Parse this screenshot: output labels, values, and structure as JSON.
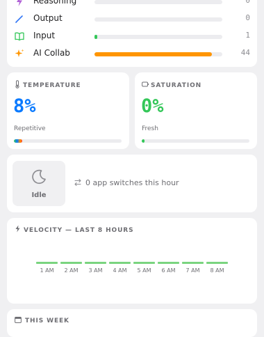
{
  "tokens": [
    {
      "label": "Reasoning",
      "count": "0",
      "fill": 0,
      "color": "#b061d6",
      "icon": "lightning-icon"
    },
    {
      "label": "Output",
      "count": "0",
      "fill": 0,
      "color": "#3478f6",
      "icon": "pencil-icon"
    },
    {
      "label": "Input",
      "count": "1",
      "fill": 0.02,
      "color": "#34c759",
      "icon": "book-icon"
    },
    {
      "label": "AI Collab",
      "count": "44",
      "fill": 0.92,
      "color": "#ff9500",
      "icon": "sparkle-icon"
    }
  ],
  "temperature": {
    "heading": "TEMPERATURE",
    "value": "8%",
    "label": "Repetitive",
    "color": "#0a7aff",
    "icon": "thermometer-icon"
  },
  "saturation": {
    "heading": "SATURATION",
    "value": "0%",
    "label": "Fresh",
    "color": "#34c759",
    "icon": "battery-icon"
  },
  "idle": {
    "label": "Idle",
    "switches": "0 app switches this hour",
    "icon": "moon-icon"
  },
  "velocity": {
    "heading": "VELOCITY — LAST 8 HOURS",
    "hours": [
      "1 AM",
      "2 AM",
      "3 AM",
      "4 AM",
      "5 AM",
      "6 AM",
      "7 AM",
      "8 AM"
    ],
    "bar_color": "#7ad47f",
    "icon": "lightning-icon"
  },
  "week": {
    "heading": "THIS WEEK",
    "icon": "calendar-icon"
  }
}
